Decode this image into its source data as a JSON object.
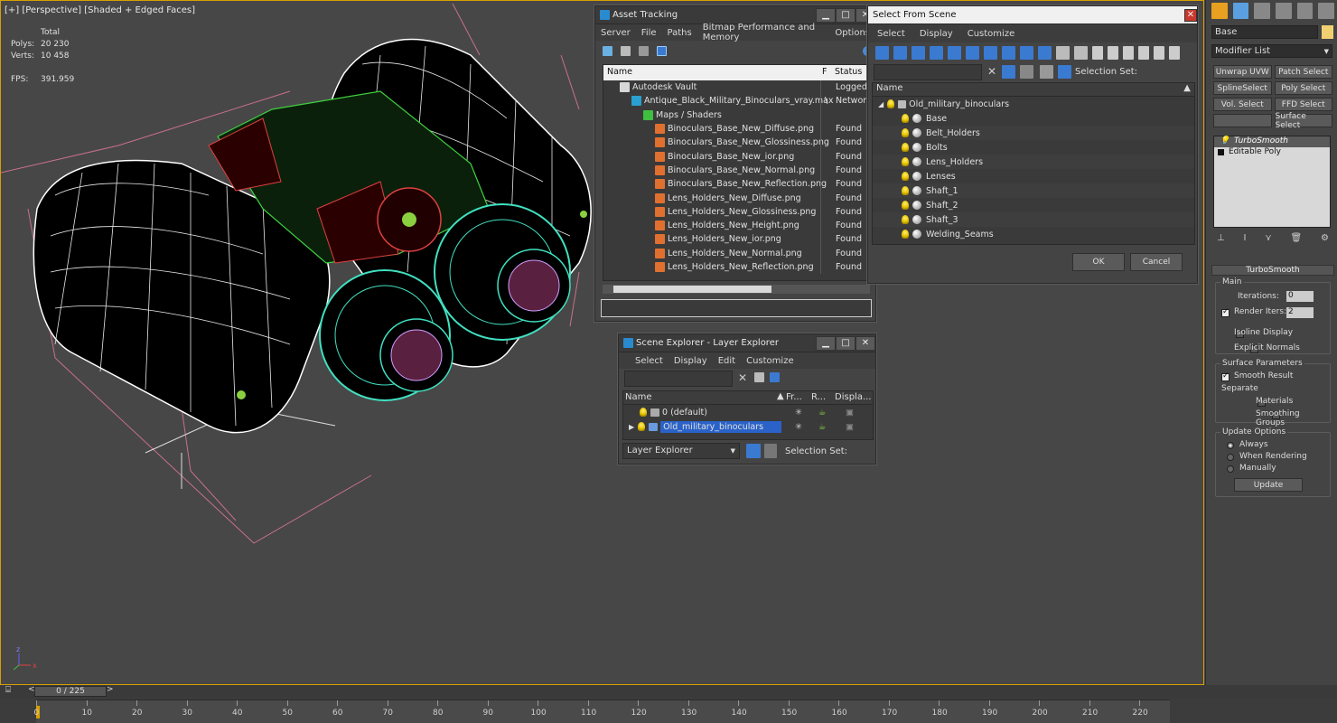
{
  "viewport": {
    "label": "[+] [Perspective] [Shaded + Edged Faces]",
    "stats_header": "Total",
    "polys_label": "Polys:",
    "polys_value": "20 230",
    "verts_label": "Verts:",
    "verts_value": "10 458",
    "fps_label": "FPS:",
    "fps_value": "391.959"
  },
  "asset_tracking": {
    "title": "Asset Tracking",
    "menu": [
      "Server",
      "File",
      "Paths",
      "Bitmap Performance and Memory",
      "Options"
    ],
    "col_name": "Name",
    "col_f": "F",
    "col_status": "Status",
    "rows": [
      {
        "name": "Autodesk Vault",
        "status": "Logged",
        "indent": 0,
        "icon": "vault"
      },
      {
        "name": "Antique_Black_Military_Binoculars_vray.max",
        "f": "\\",
        "status": "Network",
        "indent": 1,
        "icon": "max"
      },
      {
        "name": "Maps / Shaders",
        "status": "",
        "indent": 2,
        "icon": "maps"
      },
      {
        "name": "Binoculars_Base_New_Diffuse.png",
        "status": "Found",
        "indent": 3,
        "icon": "img"
      },
      {
        "name": "Binoculars_Base_New_Glossiness.png",
        "status": "Found",
        "indent": 3,
        "icon": "img"
      },
      {
        "name": "Binoculars_Base_New_ior.png",
        "status": "Found",
        "indent": 3,
        "icon": "img"
      },
      {
        "name": "Binoculars_Base_New_Normal.png",
        "status": "Found",
        "indent": 3,
        "icon": "img"
      },
      {
        "name": "Binoculars_Base_New_Reflection.png",
        "status": "Found",
        "indent": 3,
        "icon": "img"
      },
      {
        "name": "Lens_Holders_New_Diffuse.png",
        "status": "Found",
        "indent": 3,
        "icon": "img"
      },
      {
        "name": "Lens_Holders_New_Glossiness.png",
        "status": "Found",
        "indent": 3,
        "icon": "img"
      },
      {
        "name": "Lens_Holders_New_Height.png",
        "status": "Found",
        "indent": 3,
        "icon": "img"
      },
      {
        "name": "Lens_Holders_New_ior.png",
        "status": "Found",
        "indent": 3,
        "icon": "img"
      },
      {
        "name": "Lens_Holders_New_Normal.png",
        "status": "Found",
        "indent": 3,
        "icon": "img"
      },
      {
        "name": "Lens_Holders_New_Reflection.png",
        "status": "Found",
        "indent": 3,
        "icon": "img"
      }
    ]
  },
  "select_from_scene": {
    "title": "Select From Scene",
    "tabs": [
      "Select",
      "Display",
      "Customize"
    ],
    "selection_set_label": "Selection Set:",
    "col_name": "Name",
    "root": "Old_military_binoculars",
    "items": [
      "Base",
      "Belt_Holders",
      "Bolts",
      "Lens_Holders",
      "Lenses",
      "Shaft_1",
      "Shaft_2",
      "Shaft_3",
      "Welding_Seams"
    ],
    "ok": "OK",
    "cancel": "Cancel"
  },
  "scene_explorer": {
    "title": "Scene Explorer - Layer Explorer",
    "menu": [
      "Select",
      "Display",
      "Edit",
      "Customize"
    ],
    "col_name": "Name",
    "col_fr": "Fr...",
    "col_r": "R...",
    "col_display": "Displa...",
    "layers": [
      "0 (default)",
      "Old_military_binoculars"
    ],
    "footer_dropdown": "Layer Explorer",
    "selection_set_label": "Selection Set:"
  },
  "command_panel": {
    "object_name": "Base",
    "modifier_list": "Modifier List",
    "buttons": [
      "Unwrap UVW",
      "Patch Select",
      "SplineSelect",
      "Poly Select",
      "Vol. Select",
      "FFD Select",
      "",
      "Surface Select"
    ],
    "stack": [
      "TurboSmooth",
      "Editable Poly"
    ],
    "rollout_title": "TurboSmooth",
    "main_label": "Main",
    "iterations_label": "Iterations:",
    "iterations_value": "0",
    "render_iters_label": "Render Iters:",
    "render_iters_value": "2",
    "isoline_label": "Isoline Display",
    "explicit_label": "Explicit Normals",
    "surface_params_label": "Surface Parameters",
    "smooth_result_label": "Smooth Result",
    "separate_label": "Separate",
    "materials_label": "Materials",
    "smoothing_groups_label": "Smoothing Groups",
    "update_options_label": "Update Options",
    "always_label": "Always",
    "when_rendering_label": "When Rendering",
    "manually_label": "Manually",
    "update_button": "Update"
  },
  "timeline": {
    "frame_readout": "0 / 225",
    "ticks": [
      "0",
      "10",
      "20",
      "30",
      "40",
      "50",
      "60",
      "70",
      "80",
      "90",
      "100",
      "110",
      "120",
      "130",
      "140",
      "150",
      "160",
      "170",
      "180",
      "190",
      "200",
      "210",
      "220"
    ]
  },
  "colors": {
    "accent": "#d8a000",
    "selection": "#2a62c8",
    "wire_white": "#ffffff",
    "wire_green": "#3fd03f",
    "wire_red": "#e04040",
    "wire_cyan": "#40e0c0"
  }
}
